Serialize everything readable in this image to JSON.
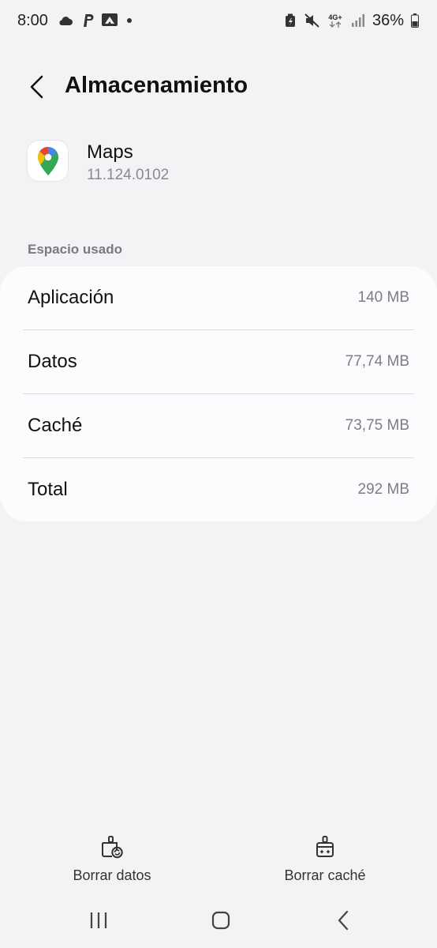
{
  "status_bar": {
    "time": "8:00",
    "battery_pct": "36%",
    "network_label": "4G+",
    "left_icons": [
      "cloud-icon",
      "paypal-icon",
      "notification-icon"
    ],
    "right_icons": [
      "battery-saver-icon",
      "mute-icon",
      "network-icon",
      "signal-icon",
      "battery-icon"
    ]
  },
  "header": {
    "title": "Almacenamiento"
  },
  "app": {
    "name": "Maps",
    "version": "11.124.0102",
    "icon": "google-maps-icon"
  },
  "storage": {
    "section_label": "Espacio usado",
    "rows": [
      {
        "label": "Aplicación",
        "value": "140 MB"
      },
      {
        "label": "Datos",
        "value": "77,74 MB"
      },
      {
        "label": "Caché",
        "value": "73,75 MB"
      },
      {
        "label": "Total",
        "value": "292 MB"
      }
    ]
  },
  "actions": {
    "clear_data": {
      "label": "Borrar datos",
      "icon": "clear-data-icon"
    },
    "clear_cache": {
      "label": "Borrar caché",
      "icon": "clear-cache-icon"
    }
  },
  "nav": {
    "recents": "recents-icon",
    "home": "home-icon",
    "back": "back-icon"
  },
  "colors": {
    "background": "#f3f3f6",
    "card": "#fcfcfe",
    "secondary_text": "#7d7d82"
  }
}
